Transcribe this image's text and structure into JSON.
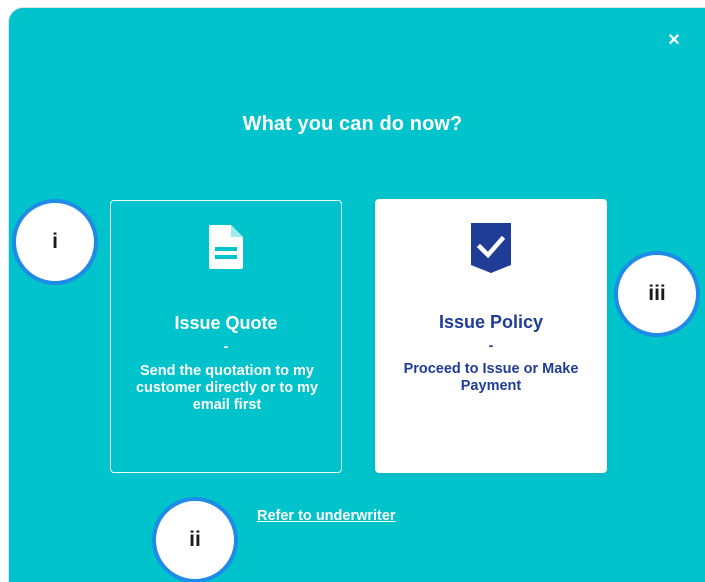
{
  "dialog": {
    "close_label": "×",
    "title": "What you can do now?",
    "bg_color": "#00c3cb"
  },
  "options": [
    {
      "title": "Issue Quote",
      "dash": "-",
      "description": "Send the quotation to my customer directly or to my email first",
      "icon": "document-icon"
    },
    {
      "title": "Issue Policy",
      "dash": "-",
      "description": "Proceed to Issue or Make Payment",
      "icon": "shield-check-icon",
      "accent_color": "#1f3c97"
    }
  ],
  "refer_link": "Refer to underwriter",
  "markers": {
    "i": "i",
    "ii": "ii",
    "iii": "iii",
    "ring_color": "#1e8be6"
  }
}
